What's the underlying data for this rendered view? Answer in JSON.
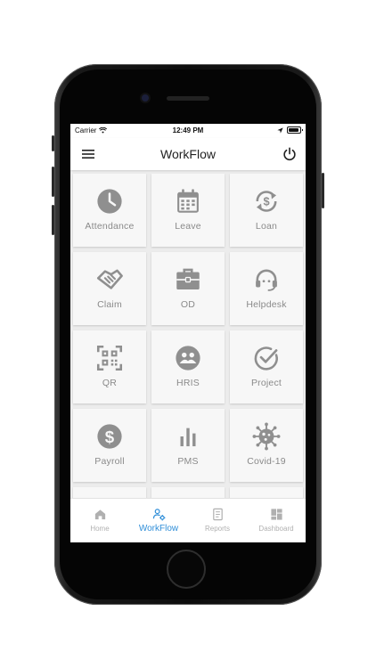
{
  "status_bar": {
    "carrier": "Carrier",
    "time": "12:49 PM"
  },
  "header": {
    "title": "WorkFlow"
  },
  "tiles": [
    {
      "label": "Attendance",
      "icon": "clock-icon"
    },
    {
      "label": "Leave",
      "icon": "calendar-icon"
    },
    {
      "label": "Loan",
      "icon": "dollar-cycle-icon"
    },
    {
      "label": "Claim",
      "icon": "handshake-icon"
    },
    {
      "label": "OD",
      "icon": "briefcase-icon"
    },
    {
      "label": "Helpdesk",
      "icon": "headset-icon"
    },
    {
      "label": "QR",
      "icon": "qr-code-icon"
    },
    {
      "label": "HRIS",
      "icon": "group-icon"
    },
    {
      "label": "Project",
      "icon": "check-circle-icon"
    },
    {
      "label": "Payroll",
      "icon": "dollar-circle-icon"
    },
    {
      "label": "PMS",
      "icon": "bar-chart-icon"
    },
    {
      "label": "Covid-19",
      "icon": "virus-icon"
    }
  ],
  "tabs": [
    {
      "label": "Home",
      "icon": "home-icon",
      "active": false
    },
    {
      "label": "WorkFlow",
      "icon": "workflow-icon",
      "active": true
    },
    {
      "label": "Reports",
      "icon": "document-icon",
      "active": false
    },
    {
      "label": "Dashboard",
      "icon": "dashboard-icon",
      "active": false
    }
  ],
  "colors": {
    "icon_gray": "#8f8f8f",
    "accent": "#2f8ed8",
    "tile_bg": "#f7f7f7",
    "grid_bg": "#ececec"
  }
}
